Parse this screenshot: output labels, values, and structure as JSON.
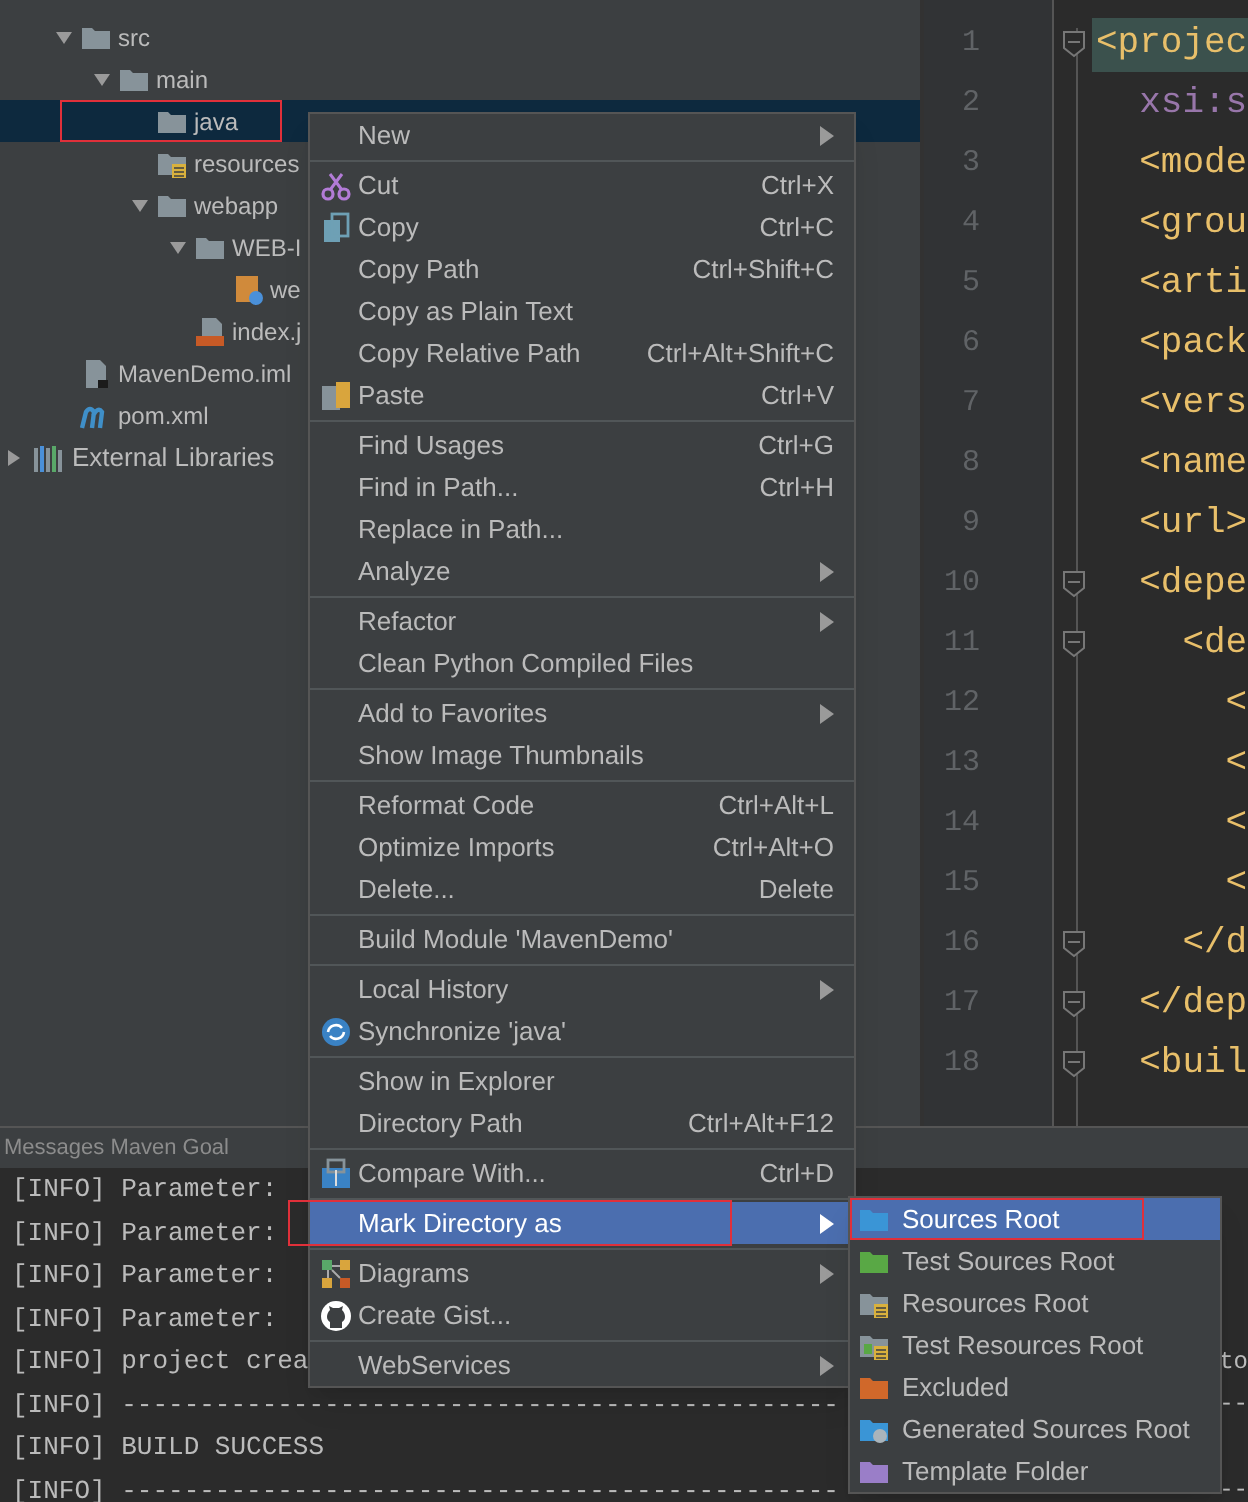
{
  "project_tree": {
    "items": [
      {
        "label": "src",
        "kind": "folder",
        "expanded": true,
        "selected": false,
        "outlined": false,
        "children": [
          {
            "label": "main",
            "kind": "folder",
            "expanded": true,
            "selected": false,
            "outlined": false,
            "children": [
              {
                "label": "java",
                "kind": "folder",
                "selected": true,
                "outlined": true
              },
              {
                "label": "resources",
                "kind": "resources-folder",
                "selected": false,
                "outlined": false
              },
              {
                "label": "webapp",
                "kind": "folder",
                "expanded": true,
                "selected": false,
                "outlined": false,
                "children": [
                  {
                    "label": "WEB-I",
                    "kind": "folder",
                    "expanded": true,
                    "selected": false,
                    "outlined": false,
                    "children": [
                      {
                        "label": "we",
                        "kind": "web-xml",
                        "selected": false,
                        "outlined": false
                      }
                    ]
                  },
                  {
                    "label": "index.j",
                    "kind": "jsp-file",
                    "selected": false,
                    "outlined": false
                  }
                ]
              }
            ]
          }
        ]
      },
      {
        "label": "MavenDemo.iml",
        "kind": "iml-file",
        "selected": false,
        "outlined": false
      },
      {
        "label": "pom.xml",
        "kind": "pom-file",
        "selected": false,
        "outlined": false
      }
    ],
    "libraries": {
      "label": "External Libraries",
      "expanded": false
    }
  },
  "editor": {
    "lines": [
      {
        "number": "1",
        "text": "<projec",
        "kind": "tag",
        "highlighted": true,
        "fold": true
      },
      {
        "number": "2",
        "text": "  xsi:s",
        "kind": "attr",
        "highlighted": false,
        "fold": false
      },
      {
        "number": "3",
        "text": "  <mode",
        "kind": "tag",
        "highlighted": false,
        "fold": false
      },
      {
        "number": "4",
        "text": "  <grou",
        "kind": "tag",
        "highlighted": false,
        "fold": false
      },
      {
        "number": "5",
        "text": "  <arti",
        "kind": "tag",
        "highlighted": false,
        "fold": false
      },
      {
        "number": "6",
        "text": "  <pack",
        "kind": "tag",
        "highlighted": false,
        "fold": false
      },
      {
        "number": "7",
        "text": "  <vers",
        "kind": "tag",
        "highlighted": false,
        "fold": false
      },
      {
        "number": "8",
        "text": "  <name",
        "kind": "tag",
        "highlighted": false,
        "fold": false
      },
      {
        "number": "9",
        "text": "  <url>",
        "kind": "tag",
        "highlighted": false,
        "fold": false
      },
      {
        "number": "10",
        "text": "  <depe",
        "kind": "tag",
        "highlighted": false,
        "fold": true
      },
      {
        "number": "11",
        "text": "    <de",
        "kind": "tag",
        "highlighted": false,
        "fold": true
      },
      {
        "number": "12",
        "text": "      <",
        "kind": "tag",
        "highlighted": false,
        "fold": false
      },
      {
        "number": "13",
        "text": "      <",
        "kind": "tag",
        "highlighted": false,
        "fold": false
      },
      {
        "number": "14",
        "text": "      <",
        "kind": "tag",
        "highlighted": false,
        "fold": false
      },
      {
        "number": "15",
        "text": "      <",
        "kind": "tag",
        "highlighted": false,
        "fold": false
      },
      {
        "number": "16",
        "text": "    </d",
        "kind": "tag",
        "highlighted": false,
        "fold": true
      },
      {
        "number": "17",
        "text": "  </dep",
        "kind": "tag",
        "highlighted": false,
        "fold": true
      },
      {
        "number": "18",
        "text": "  <buil",
        "kind": "tag",
        "highlighted": false,
        "fold": true
      }
    ]
  },
  "console": {
    "title": "Messages Maven Goal",
    "lines": [
      {
        "text": "[INFO] Parameter:"
      },
      {
        "text": "[INFO] Parameter:"
      },
      {
        "text": "[INFO] Parameter:"
      },
      {
        "text": "[INFO] Parameter:"
      },
      {
        "text": "[INFO] project crea",
        "tail": "to"
      },
      {
        "text": "[INFO] ----------------------------------------------",
        "tail": "--"
      },
      {
        "text": "[INFO] BUILD SUCCESS"
      },
      {
        "text": "[INFO] ----------------------------------------------",
        "tail": "--"
      }
    ]
  },
  "context_menu": {
    "items": [
      {
        "kind": "item",
        "label": "New",
        "submenu": true,
        "selected": false,
        "outlined": false
      },
      {
        "kind": "separator"
      },
      {
        "kind": "item",
        "label": "Cut",
        "shortcut": "Ctrl+X",
        "submenu": false,
        "selected": false,
        "outlined": false
      },
      {
        "kind": "item",
        "label": "Copy",
        "shortcut": "Ctrl+C",
        "submenu": false,
        "selected": false,
        "outlined": false
      },
      {
        "kind": "item",
        "label": "Copy Path",
        "shortcut": "Ctrl+Shift+C",
        "submenu": false,
        "selected": false,
        "outlined": false
      },
      {
        "kind": "item",
        "label": "Copy as Plain Text",
        "submenu": false,
        "selected": false,
        "outlined": false
      },
      {
        "kind": "item",
        "label": "Copy Relative Path",
        "shortcut": "Ctrl+Alt+Shift+C",
        "submenu": false,
        "selected": false,
        "outlined": false
      },
      {
        "kind": "item",
        "label": "Paste",
        "shortcut": "Ctrl+V",
        "submenu": false,
        "selected": false,
        "outlined": false
      },
      {
        "kind": "separator"
      },
      {
        "kind": "item",
        "label": "Find Usages",
        "shortcut": "Ctrl+G",
        "submenu": false,
        "selected": false,
        "outlined": false
      },
      {
        "kind": "item",
        "label": "Find in Path...",
        "shortcut": "Ctrl+H",
        "submenu": false,
        "selected": false,
        "outlined": false
      },
      {
        "kind": "item",
        "label": "Replace in Path...",
        "submenu": false,
        "selected": false,
        "outlined": false
      },
      {
        "kind": "item",
        "label": "Analyze",
        "submenu": true,
        "selected": false,
        "outlined": false
      },
      {
        "kind": "separator"
      },
      {
        "kind": "item",
        "label": "Refactor",
        "submenu": true,
        "selected": false,
        "outlined": false
      },
      {
        "kind": "item",
        "label": "Clean Python Compiled Files",
        "submenu": false,
        "selected": false,
        "outlined": false
      },
      {
        "kind": "separator"
      },
      {
        "kind": "item",
        "label": "Add to Favorites",
        "submenu": true,
        "selected": false,
        "outlined": false
      },
      {
        "kind": "item",
        "label": "Show Image Thumbnails",
        "submenu": false,
        "selected": false,
        "outlined": false
      },
      {
        "kind": "separator"
      },
      {
        "kind": "item",
        "label": "Reformat Code",
        "shortcut": "Ctrl+Alt+L",
        "submenu": false,
        "selected": false,
        "outlined": false
      },
      {
        "kind": "item",
        "label": "Optimize Imports",
        "shortcut": "Ctrl+Alt+O",
        "submenu": false,
        "selected": false,
        "outlined": false
      },
      {
        "kind": "item",
        "label": "Delete...",
        "shortcut": "Delete",
        "submenu": false,
        "selected": false,
        "outlined": false
      },
      {
        "kind": "separator"
      },
      {
        "kind": "item",
        "label": "Build Module 'MavenDemo'",
        "submenu": false,
        "selected": false,
        "outlined": false
      },
      {
        "kind": "separator"
      },
      {
        "kind": "item",
        "label": "Local History",
        "submenu": true,
        "selected": false,
        "outlined": false
      },
      {
        "kind": "item",
        "label": "Synchronize 'java'",
        "submenu": false,
        "selected": false,
        "outlined": false
      },
      {
        "kind": "separator"
      },
      {
        "kind": "item",
        "label": "Show in Explorer",
        "submenu": false,
        "selected": false,
        "outlined": false
      },
      {
        "kind": "item",
        "label": "Directory Path",
        "shortcut": "Ctrl+Alt+F12",
        "submenu": false,
        "selected": false,
        "outlined": false
      },
      {
        "kind": "separator"
      },
      {
        "kind": "item",
        "label": "Compare With...",
        "shortcut": "Ctrl+D",
        "submenu": false,
        "selected": false,
        "outlined": false
      },
      {
        "kind": "separator"
      },
      {
        "kind": "item",
        "label": "Mark Directory as",
        "submenu": true,
        "selected": true,
        "outlined": true
      },
      {
        "kind": "separator"
      },
      {
        "kind": "item",
        "label": "Diagrams",
        "submenu": true,
        "selected": false,
        "outlined": false
      },
      {
        "kind": "item",
        "label": "Create Gist...",
        "submenu": false,
        "selected": false,
        "outlined": false
      },
      {
        "kind": "separator"
      },
      {
        "kind": "item",
        "label": "WebServices",
        "submenu": true,
        "selected": false,
        "outlined": false
      }
    ]
  },
  "submenu": {
    "items": [
      {
        "label": "Sources Root",
        "selected": true,
        "outlined": true
      },
      {
        "label": "Test Sources Root",
        "selected": false,
        "outlined": false
      },
      {
        "label": "Resources Root",
        "selected": false,
        "outlined": false
      },
      {
        "label": "Test Resources Root",
        "selected": false,
        "outlined": false
      },
      {
        "label": "Excluded",
        "selected": false,
        "outlined": false
      },
      {
        "label": "Generated Sources Root",
        "selected": false,
        "outlined": false
      },
      {
        "label": "Template Folder",
        "selected": false,
        "outlined": false
      }
    ]
  }
}
